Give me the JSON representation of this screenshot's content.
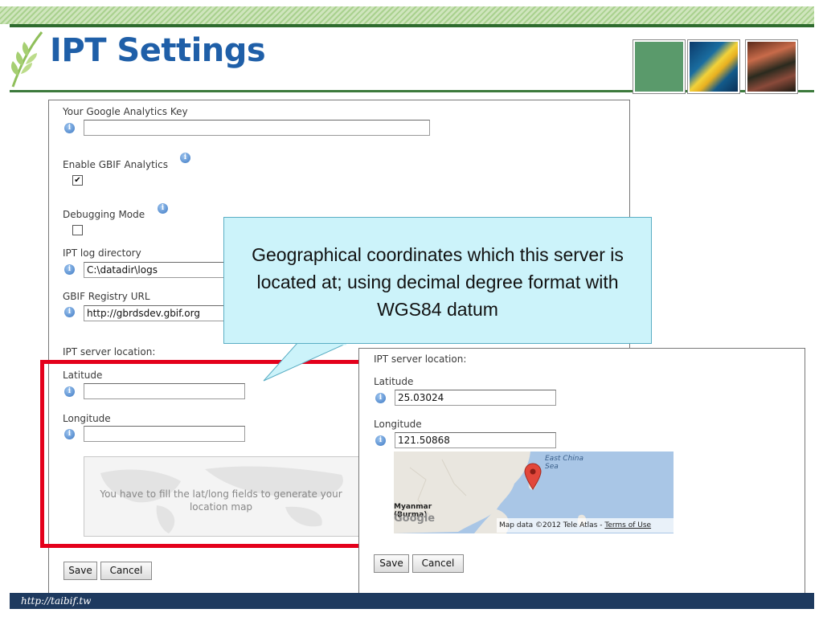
{
  "header": {
    "title": "IPT Settings"
  },
  "footer": {
    "url": "http://taibif.tw"
  },
  "form_left": {
    "analytics_key_label": "Your Google Analytics Key",
    "analytics_key_value": "",
    "enable_gbif_label": "Enable GBIF Analytics",
    "enable_gbif_checked": true,
    "debugging_label": "Debugging Mode",
    "debugging_checked": false,
    "log_dir_label": "IPT log directory",
    "log_dir_value": "C:\\datadir\\logs",
    "registry_label": "GBIF Registry URL",
    "registry_value": "http://gbrdsdev.gbif.org",
    "location_label": "IPT server location:",
    "latitude_label": "Latitude",
    "latitude_value": "",
    "longitude_label": "Longitude",
    "longitude_value": "",
    "map_placeholder": "You have to fill the lat/long fields to generate your location map",
    "save_label": "Save",
    "cancel_label": "Cancel"
  },
  "callout": {
    "text": "Geographical coordinates which this server is located at; using decimal degree format with WGS84 datum"
  },
  "form_right": {
    "location_label": "IPT server location:",
    "latitude_label": "Latitude",
    "latitude_value": "25.03024",
    "longitude_label": "Longitude",
    "longitude_value": "121.50868",
    "map_label_sea": "East China Sea",
    "map_label_myanmar": "Myanmar (Burma)",
    "map_logo": "Google",
    "map_attribution": "Map data ©2012 Tele Atlas - ",
    "map_terms": "Terms of Use",
    "save_label": "Save",
    "cancel_label": "Cancel"
  },
  "colors": {
    "title": "#1f5fa8",
    "highlight_box": "#e4001b",
    "callout_bg": "#ccf3fa",
    "footer_bg": "#1e3a5f"
  }
}
